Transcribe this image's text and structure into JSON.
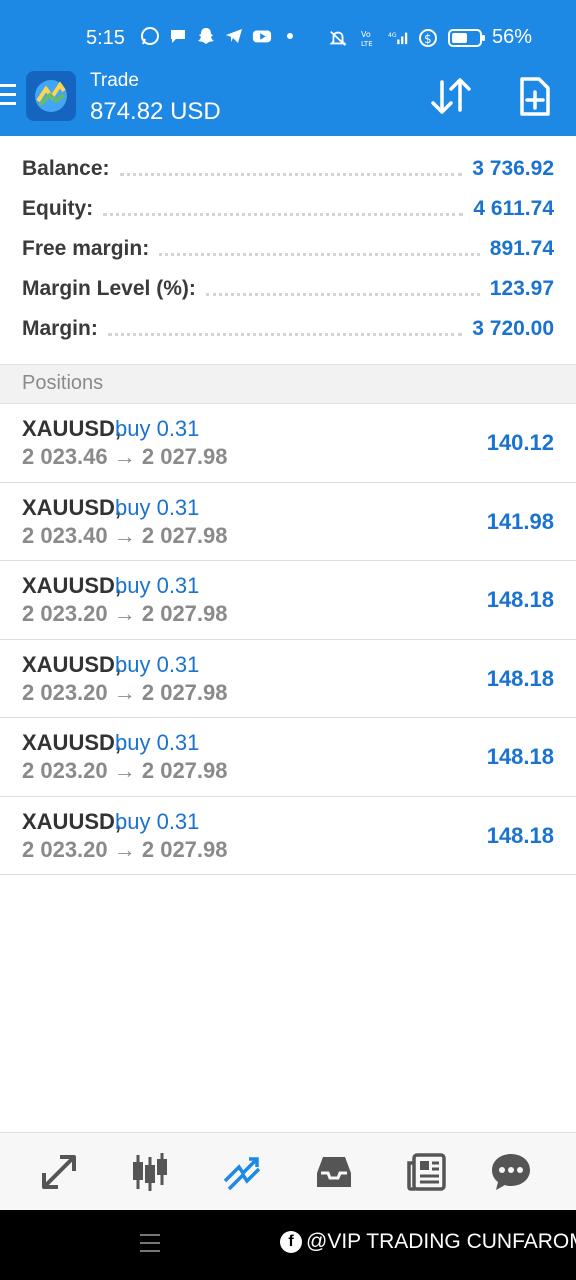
{
  "status_bar": {
    "time": "5:15",
    "battery_percent": "56%",
    "battery_level": 0.56,
    "left_icons": [
      "whatsapp-icon",
      "messages-icon",
      "snapchat-icon",
      "telegram-icon",
      "youtube-icon",
      "dot-icon"
    ],
    "right_icons": [
      "mute-icon",
      "volte-icon",
      "signal-4g-icon",
      "dollar-shield-icon"
    ]
  },
  "appbar": {
    "title": "Trade",
    "subtitle": "874.82 USD",
    "icons": [
      "menu-icon",
      "metatrader-logo",
      "sort-icon",
      "new-order-icon"
    ]
  },
  "summary": {
    "rows": [
      {
        "label": "Balance:",
        "value": "3 736.92"
      },
      {
        "label": "Equity:",
        "value": "4 611.74"
      },
      {
        "label": "Free margin:",
        "value": "891.74"
      },
      {
        "label": "Margin Level (%):",
        "value": "123.97"
      },
      {
        "label": "Margin:",
        "value": "3 720.00"
      }
    ]
  },
  "positions_header": "Positions",
  "positions": [
    {
      "symbol": "XAUUSD,",
      "direction": "buy 0.31",
      "prices": "2 023.46 → 2 027.98",
      "profit": "140.12"
    },
    {
      "symbol": "XAUUSD,",
      "direction": "buy 0.31",
      "prices": "2 023.40 → 2 027.98",
      "profit": "141.98"
    },
    {
      "symbol": "XAUUSD,",
      "direction": "buy 0.31",
      "prices": "2 023.20 → 2 027.98",
      "profit": "148.18"
    },
    {
      "symbol": "XAUUSD,",
      "direction": "buy 0.31",
      "prices": "2 023.20 → 2 027.98",
      "profit": "148.18"
    },
    {
      "symbol": "XAUUSD,",
      "direction": "buy 0.31",
      "prices": "2 023.20 → 2 027.98",
      "profit": "148.18"
    },
    {
      "symbol": "XAUUSD,",
      "direction": "buy 0.31",
      "prices": "2 023.20 → 2 027.98",
      "profit": "148.18"
    }
  ],
  "bottom_nav": {
    "items": [
      "quotes-icon",
      "chart-icon",
      "trade-icon",
      "history-icon",
      "news-icon",
      "messages-icon"
    ],
    "active": "trade-icon",
    "active_color": "#1e88e5",
    "inactive_color": "#555555"
  },
  "system_bar": {
    "watermark": "@VIP TRADING CUNFAROM",
    "watermark_logo": "f"
  },
  "colors": {
    "app_bar": "#1e88e5",
    "accent_value": "#1a73d0"
  }
}
